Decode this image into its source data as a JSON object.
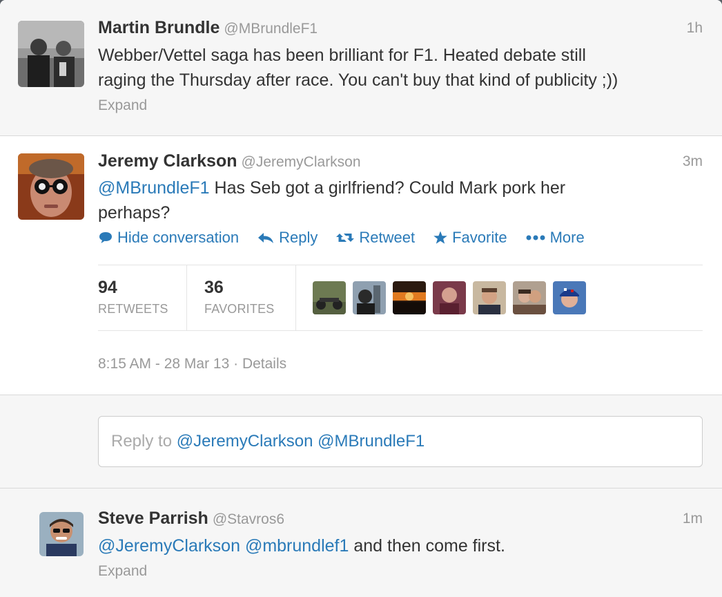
{
  "tweets": [
    {
      "name": "Martin Brundle",
      "handle": "@MBrundleF1",
      "time": "1h",
      "line1": "Webber/Vettel saga has been brilliant for F1. Heated debate still",
      "line2": "raging the Thursday after race. You can't buy that kind of publicity ;))",
      "expand": "Expand"
    },
    {
      "name": "Jeremy Clarkson",
      "handle": "@JeremyClarkson",
      "time": "3m",
      "mention": "@MBrundleF1",
      "text1": " Has Seb got a girlfriend? Could Mark pork her",
      "text2": "perhaps?",
      "actions": {
        "hide": "Hide conversation",
        "reply": "Reply",
        "retweet": "Retweet",
        "favorite": "Favorite",
        "more": "More"
      },
      "stats": {
        "retweets_count": "94",
        "retweets_label": "RETWEETS",
        "favorites_count": "36",
        "favorites_label": "FAVORITES"
      },
      "timestamp": "8:15 AM - 28 Mar 13",
      "separator": " · ",
      "details": "Details"
    },
    {
      "name": "Steve Parrish",
      "handle": "@Stavros6",
      "time": "1m",
      "mention1": "@JeremyClarkson",
      "mention2": "@mbrundlef1",
      "text": " and then come first.",
      "expand": "Expand"
    }
  ],
  "reply_box": {
    "prefix": "Reply to ",
    "mentions": "@JeremyClarkson @MBrundleF1"
  },
  "colors": {
    "link": "#2a7ab8",
    "muted": "#999999",
    "text": "#333333"
  },
  "icons": [
    "speech-bubble-icon",
    "reply-arrow-icon",
    "retweet-icon",
    "star-icon",
    "more-dots-icon"
  ]
}
